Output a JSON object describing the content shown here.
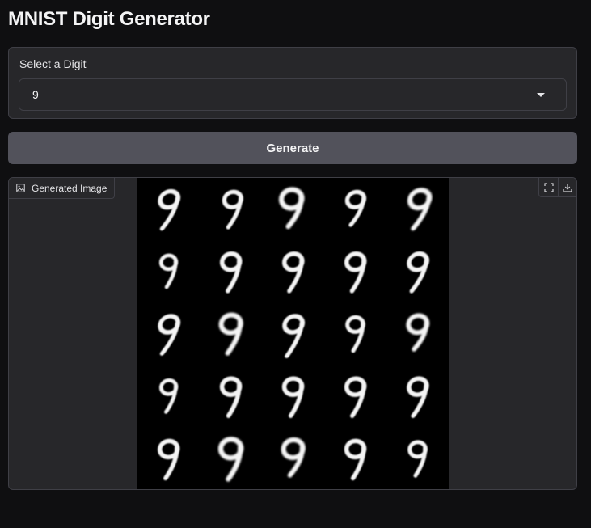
{
  "page": {
    "title": "MNIST Digit Generator"
  },
  "digit_select": {
    "label": "Select a Digit",
    "value": "9",
    "icon": "chevron-down-icon"
  },
  "generate": {
    "label": "Generate"
  },
  "output": {
    "label": "Generated Image",
    "label_icon": "image-icon",
    "toolbar": [
      "fullscreen-icon",
      "download-icon"
    ],
    "grid": {
      "rows": 5,
      "cols": 5,
      "digit": "9"
    }
  },
  "colors": {
    "background": "#0f0f11",
    "panel": "#27272a",
    "border": "#3f3f46",
    "button": "#52525b",
    "text": "#f4f4f5"
  }
}
